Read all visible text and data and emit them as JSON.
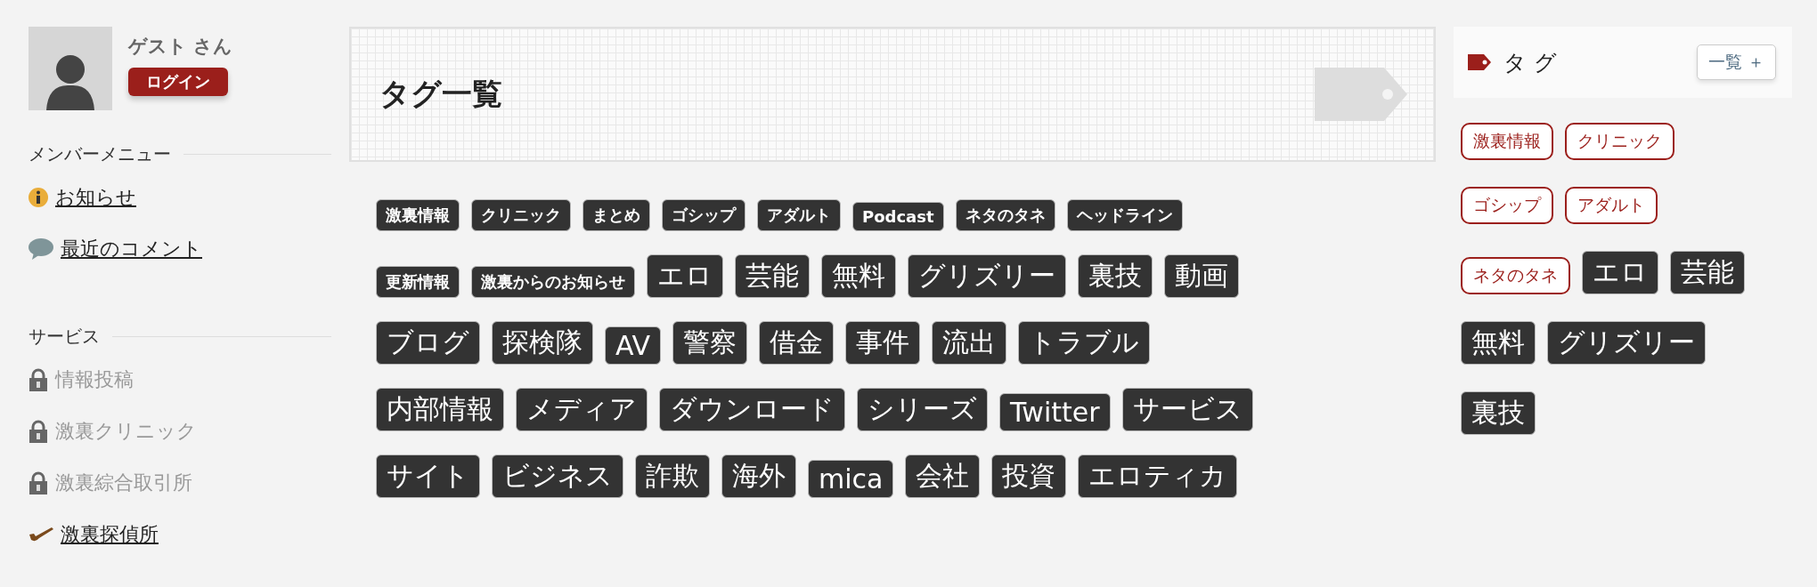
{
  "user": {
    "name": "ゲスト さん",
    "login_button": "ログイン"
  },
  "sidebar": {
    "sections": [
      {
        "title": "メンバーメニュー",
        "items": [
          {
            "label": "お知らせ",
            "kind": "info",
            "disabled": false
          },
          {
            "label": "最近のコメント",
            "kind": "comment",
            "disabled": false
          }
        ]
      },
      {
        "title": "サービス",
        "items": [
          {
            "label": "情報投稿",
            "kind": "lock",
            "disabled": true
          },
          {
            "label": "激裏クリニック",
            "kind": "lock",
            "disabled": true
          },
          {
            "label": "激裏綜合取引所",
            "kind": "lock",
            "disabled": true
          },
          {
            "label": "激裏探偵所",
            "kind": "pipe",
            "disabled": false
          }
        ]
      }
    ]
  },
  "main": {
    "title": "タグ一覧",
    "tag_rows": [
      [
        {
          "label": "激裏情報",
          "kind": "small"
        },
        {
          "label": "クリニック",
          "kind": "small"
        },
        {
          "label": "まとめ",
          "kind": "small"
        },
        {
          "label": "ゴシップ",
          "kind": "small"
        },
        {
          "label": "アダルト",
          "kind": "small"
        },
        {
          "label": "Podcast",
          "kind": "small"
        },
        {
          "label": "ネタのタネ",
          "kind": "small"
        },
        {
          "label": "ヘッドライン",
          "kind": "small"
        }
      ],
      [
        {
          "label": "更新情報",
          "kind": "small"
        },
        {
          "label": "激裏からのお知らせ",
          "kind": "small"
        },
        {
          "label": "エロ",
          "kind": "large"
        },
        {
          "label": "芸能",
          "kind": "large"
        },
        {
          "label": "無料",
          "kind": "large"
        },
        {
          "label": "グリズリー",
          "kind": "large"
        },
        {
          "label": "裏技",
          "kind": "large"
        },
        {
          "label": "動画",
          "kind": "large"
        }
      ],
      [
        {
          "label": "ブログ",
          "kind": "large"
        },
        {
          "label": "探検隊",
          "kind": "large"
        },
        {
          "label": "AV",
          "kind": "large"
        },
        {
          "label": "警察",
          "kind": "large"
        },
        {
          "label": "借金",
          "kind": "large"
        },
        {
          "label": "事件",
          "kind": "large"
        },
        {
          "label": "流出",
          "kind": "large"
        },
        {
          "label": "トラブル",
          "kind": "large"
        }
      ],
      [
        {
          "label": "内部情報",
          "kind": "large"
        },
        {
          "label": "メディア",
          "kind": "large"
        },
        {
          "label": "ダウンロード",
          "kind": "large"
        },
        {
          "label": "シリーズ",
          "kind": "large"
        },
        {
          "label": "Twitter",
          "kind": "large"
        },
        {
          "label": "サービス",
          "kind": "large"
        }
      ],
      [
        {
          "label": "サイト",
          "kind": "large"
        },
        {
          "label": "ビジネス",
          "kind": "large"
        },
        {
          "label": "詐欺",
          "kind": "large"
        },
        {
          "label": "海外",
          "kind": "large"
        },
        {
          "label": "mica",
          "kind": "large"
        },
        {
          "label": "会社",
          "kind": "large"
        },
        {
          "label": "投資",
          "kind": "large"
        },
        {
          "label": "エロティカ",
          "kind": "large"
        }
      ]
    ]
  },
  "widget": {
    "title": "タ グ",
    "list_button": "一覧 ＋",
    "tag_rows": [
      [
        {
          "label": "激裏情報",
          "kind": "outline"
        },
        {
          "label": "クリニック",
          "kind": "outline"
        }
      ],
      [
        {
          "label": "ゴシップ",
          "kind": "outline"
        },
        {
          "label": "アダルト",
          "kind": "outline"
        }
      ],
      [
        {
          "label": "ネタのタネ",
          "kind": "outline"
        },
        {
          "label": "エロ",
          "kind": "large"
        },
        {
          "label": "芸能",
          "kind": "large"
        }
      ],
      [
        {
          "label": "無料",
          "kind": "large"
        },
        {
          "label": "グリズリー",
          "kind": "large"
        }
      ],
      [
        {
          "label": "裏技",
          "kind": "large"
        }
      ]
    ]
  }
}
